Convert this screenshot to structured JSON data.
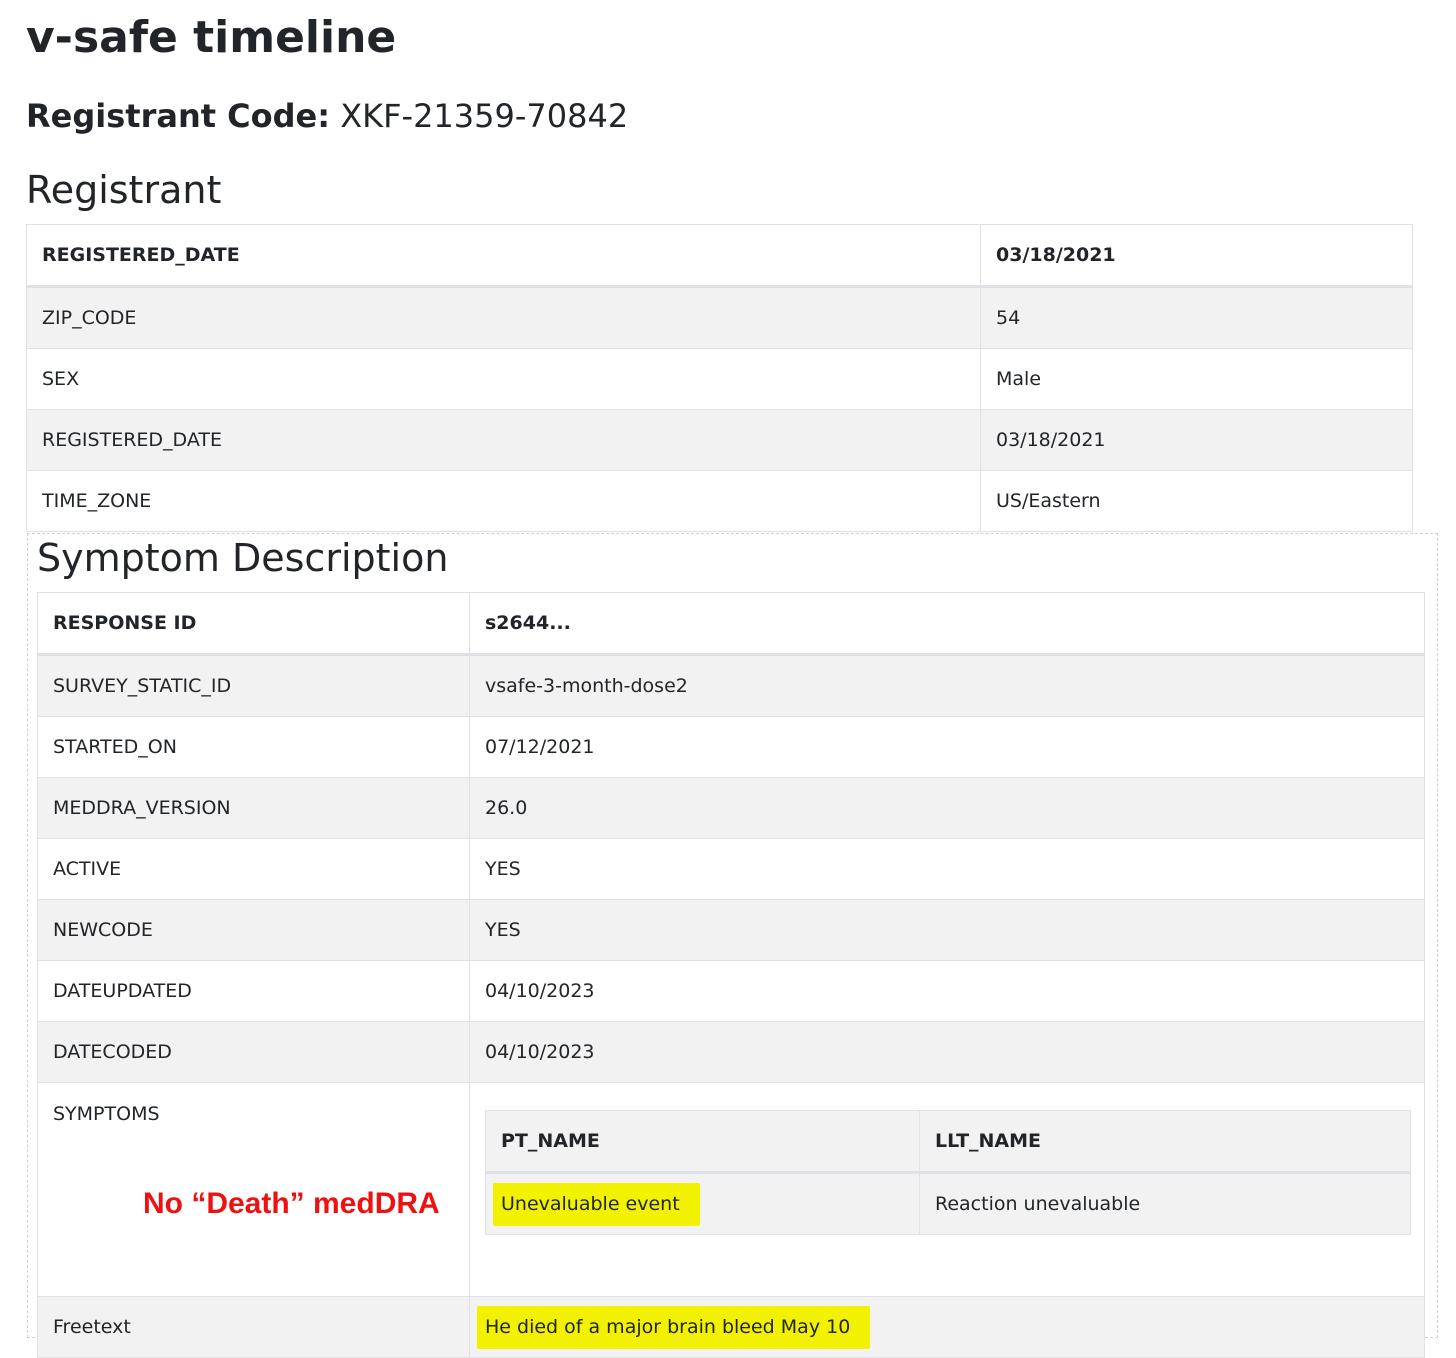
{
  "header": {
    "title": "v-safe timeline",
    "registrant_code_label": "Registrant Code:",
    "registrant_code_value": "XKF-21359-70842"
  },
  "registrant": {
    "heading": "Registrant",
    "head_row": {
      "key": "REGISTERED_DATE",
      "value": "03/18/2021"
    },
    "rows": [
      {
        "key": "ZIP_CODE",
        "value": "54"
      },
      {
        "key": "SEX",
        "value": "Male"
      },
      {
        "key": "REGISTERED_DATE",
        "value": "03/18/2021"
      },
      {
        "key": "TIME_ZONE",
        "value": "US/Eastern"
      }
    ]
  },
  "symptom": {
    "heading": "Symptom Description",
    "head_row": {
      "key": "RESPONSE ID",
      "value": "s2644..."
    },
    "rows": [
      {
        "key": "SURVEY_STATIC_ID",
        "value": "vsafe-3-month-dose2"
      },
      {
        "key": "STARTED_ON",
        "value": "07/12/2021"
      },
      {
        "key": "MEDDRA_VERSION",
        "value": "26.0"
      },
      {
        "key": "ACTIVE",
        "value": "YES"
      },
      {
        "key": "NEWCODE",
        "value": "YES"
      },
      {
        "key": "DATEUPDATED",
        "value": "04/10/2023"
      },
      {
        "key": "DATECODED",
        "value": "04/10/2023"
      }
    ],
    "symptoms_key": "SYMPTOMS",
    "symptoms_table": {
      "headers": [
        "PT_NAME",
        "LLT_NAME"
      ],
      "rows": [
        [
          "Unevaluable event",
          "Reaction unevaluable"
        ]
      ]
    },
    "freetext_key": "Freetext",
    "freetext_value": "He died of a major brain bleed May 10"
  },
  "annotation": {
    "text": "No “Death” medDRA",
    "color": "#ee1111"
  },
  "colors": {
    "highlight": "#f2f200",
    "stripe": "#f2f2f2",
    "border": "#dee2e6"
  }
}
